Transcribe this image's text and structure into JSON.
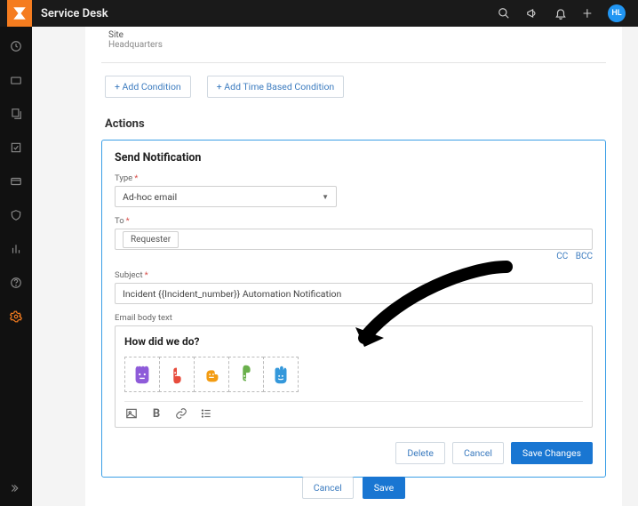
{
  "header": {
    "app_title": "Service Desk",
    "avatar_initials": "HL"
  },
  "site": {
    "label": "Site",
    "value": "Headquarters"
  },
  "condition_buttons": {
    "add_condition": "+ Add Condition",
    "add_time_condition": "+ Add Time Based Condition"
  },
  "actions_section_title": "Actions",
  "card": {
    "title": "Send Notification",
    "type_label": "Type",
    "type_value": "Ad-hoc email",
    "to_label": "To",
    "to_chip": "Requester",
    "cc_label": "CC",
    "bcc_label": "BCC",
    "subject_label": "Subject",
    "subject_value": "Incident {{Incident_number}} Automation Notification",
    "body_label": "Email body text",
    "body_heading": "How did we do?",
    "buttons": {
      "delete": "Delete",
      "cancel": "Cancel",
      "save": "Save Changes"
    }
  },
  "footer": {
    "cancel": "Cancel",
    "save": "Save"
  }
}
